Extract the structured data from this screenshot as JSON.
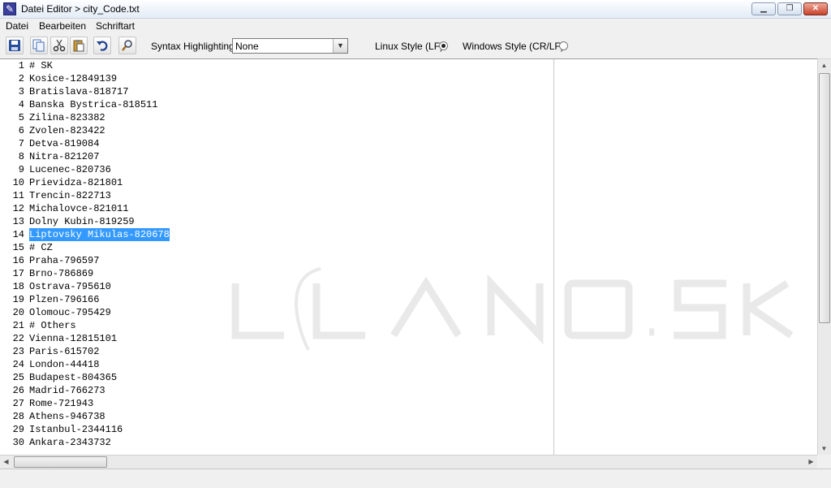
{
  "window": {
    "title": "Datei Editor > city_Code.txt",
    "app_icon": "notepad-icon",
    "controls": [
      "minimize-icon",
      "maximize-icon",
      "close-icon"
    ]
  },
  "menu": [
    "Datei",
    "Bearbeiten",
    "Schriftart"
  ],
  "toolbar": {
    "buttons": [
      "save-icon",
      "copy-icon",
      "cut-icon",
      "paste-icon",
      "undo-icon",
      "find-icon"
    ],
    "syntax_label": "Syntax Highlighting:",
    "syntax_value": "None",
    "linux_label": "Linux Style (LF)",
    "windows_label": "Windows Style (CR/LF)",
    "line_ending": "Linux Style (LF)"
  },
  "editor": {
    "lines": [
      {
        "n": "1",
        "text": "# SK"
      },
      {
        "n": "2",
        "text": "Kosice-12849139"
      },
      {
        "n": "3",
        "text": "Bratislava-818717"
      },
      {
        "n": "4",
        "text": "Banska Bystrica-818511"
      },
      {
        "n": "5",
        "text": "Zilina-823382"
      },
      {
        "n": "6",
        "text": "Zvolen-823422"
      },
      {
        "n": "7",
        "text": "Detva-819084"
      },
      {
        "n": "8",
        "text": "Nitra-821207"
      },
      {
        "n": "9",
        "text": "Lucenec-820736"
      },
      {
        "n": "10",
        "text": "Prievidza-821801"
      },
      {
        "n": "11",
        "text": "Trencin-822713"
      },
      {
        "n": "12",
        "text": "Michalovce-821011"
      },
      {
        "n": "13",
        "text": "Dolny Kubin-819259"
      },
      {
        "n": "14",
        "text": "Liptovsky Mikulas-820678",
        "selected": true
      },
      {
        "n": "15",
        "text": "# CZ"
      },
      {
        "n": "16",
        "text": "Praha-796597"
      },
      {
        "n": "17",
        "text": "Brno-786869"
      },
      {
        "n": "18",
        "text": "Ostrava-795610"
      },
      {
        "n": "19",
        "text": "Plzen-796166"
      },
      {
        "n": "20",
        "text": "Olomouc-795429"
      },
      {
        "n": "21",
        "text": "# Others"
      },
      {
        "n": "22",
        "text": "Vienna-12815101"
      },
      {
        "n": "23",
        "text": "Paris-615702"
      },
      {
        "n": "24",
        "text": "London-44418"
      },
      {
        "n": "25",
        "text": "Budapest-804365"
      },
      {
        "n": "26",
        "text": "Madrid-766273"
      },
      {
        "n": "27",
        "text": "Rome-721943"
      },
      {
        "n": "28",
        "text": "Athens-946738"
      },
      {
        "n": "29",
        "text": "Istanbul-2344116"
      },
      {
        "n": "30",
        "text": "Ankara-2343732"
      }
    ],
    "selection_color": "#3399ff",
    "watermark": "LLANO.SK"
  }
}
